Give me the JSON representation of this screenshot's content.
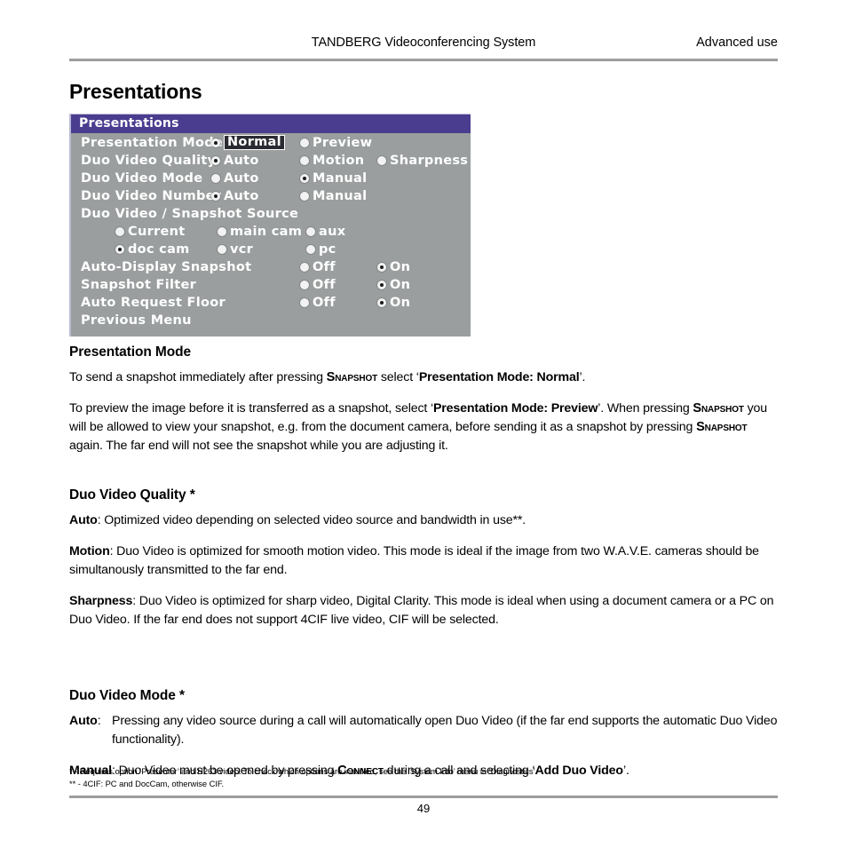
{
  "header": {
    "center": "TANDBERG Videoconferencing System",
    "right": "Advanced use"
  },
  "page_title": "Presentations",
  "menu": {
    "title": "Presentations",
    "rows": [
      {
        "label": "Presentation Mode",
        "options": [
          {
            "text": "Normal",
            "selected": true,
            "focused": true
          },
          {
            "text": "Preview",
            "selected": false,
            "focused": false
          }
        ]
      },
      {
        "label": "Duo Video Quality",
        "options": [
          {
            "text": "Auto",
            "selected": true,
            "focused": false
          },
          {
            "text": "Motion",
            "selected": false,
            "focused": false
          },
          {
            "text": "Sharpness",
            "selected": false,
            "focused": false
          }
        ]
      },
      {
        "label": "Duo Video Mode",
        "options": [
          {
            "text": "Auto",
            "selected": false,
            "focused": false
          },
          {
            "text": "Manual",
            "selected": true,
            "focused": false
          }
        ]
      },
      {
        "label": "Duo Video Number",
        "options": [
          {
            "text": "Auto",
            "selected": true,
            "focused": false
          },
          {
            "text": "Manual",
            "selected": false,
            "focused": false
          }
        ]
      }
    ],
    "source_header": "Duo Video / Snapshot Source",
    "source_row_1": [
      {
        "text": "Current",
        "selected": false
      },
      {
        "text": "main cam",
        "selected": false
      },
      {
        "text": "aux",
        "selected": false
      }
    ],
    "source_row_2": [
      {
        "text": "doc cam",
        "selected": true
      },
      {
        "text": "vcr",
        "selected": false
      },
      {
        "text": "pc",
        "selected": false
      }
    ],
    "toggle_rows": [
      {
        "label": "Auto-Display Snapshot",
        "off": {
          "text": "Off",
          "selected": false
        },
        "on": {
          "text": "On",
          "selected": true
        }
      },
      {
        "label": "Snapshot Filter",
        "off": {
          "text": "Off",
          "selected": false
        },
        "on": {
          "text": "On",
          "selected": true
        }
      },
      {
        "label": "Auto Request Floor",
        "off": {
          "text": "Off",
          "selected": false
        },
        "on": {
          "text": "On",
          "selected": true
        }
      }
    ],
    "previous_menu": "Previous Menu"
  },
  "sections": {
    "presentation_mode": {
      "heading": "Presentation Mode",
      "p1_a": "To send a snapshot immediately after pressing ",
      "p1_sc": "Snapshot",
      "p1_b": " select ‘",
      "p1_bold": "Presentation Mode: Normal",
      "p1_c": "’.",
      "p2_a": "To preview the image before it is transferred as a snapshot, select ‘",
      "p2_bold": "Presentation Mode: Preview",
      "p2_b": "’. When pressing ",
      "p2_sc1": "Snapshot",
      "p2_c": " you will be allowed to view your snapshot, e.g. from the document camera, before sending it as a snapshot by pressing ",
      "p2_sc2": "Snapshot",
      "p2_d": " again. The far end will not see the snapshot while you are adjusting it."
    },
    "duo_video_quality": {
      "heading": "Duo Video Quality *",
      "auto_term": "Auto",
      "auto_text": ": Optimized video depending on selected video source and bandwidth in use**.",
      "motion_term": "Motion",
      "motion_text": ": Duo Video is optimized for smooth motion video. This mode is ideal if the image from two W.A.V.E. cameras should be simultanously transmitted to the far end.",
      "sharpness_term": "Sharpness",
      "sharpness_text": ": Duo Video is optimized for sharp video, Digital Clarity. This mode is ideal when using a document camera or a PC on Duo Video. If the far end does not support 4CIF live video, CIF will be selected."
    },
    "duo_video_mode": {
      "heading": "Duo Video Mode *",
      "auto_term": "Auto",
      "auto_colon": ":",
      "auto_text": "Pressing any video source during a call will automatically open Duo Video (if the far end supports the automatic Duo Video functionality).",
      "manual_term": "Manual",
      "manual_a": ": Duo Video must be opened by pressing ",
      "manual_sc": "Connect",
      "manual_b": " during a call and selecting ‘",
      "manual_bold": "Add Duo Video",
      "manual_c": "’."
    }
  },
  "footnotes": [
    "* - Requires option ‘Presenter’ and H263 video. To check which options are installed, see the ‘System Info’ menu in ‘Diagnostics’.",
    "** - 4CIF: PC and DocCam, otherwise CIF."
  ],
  "page_number": "49"
}
